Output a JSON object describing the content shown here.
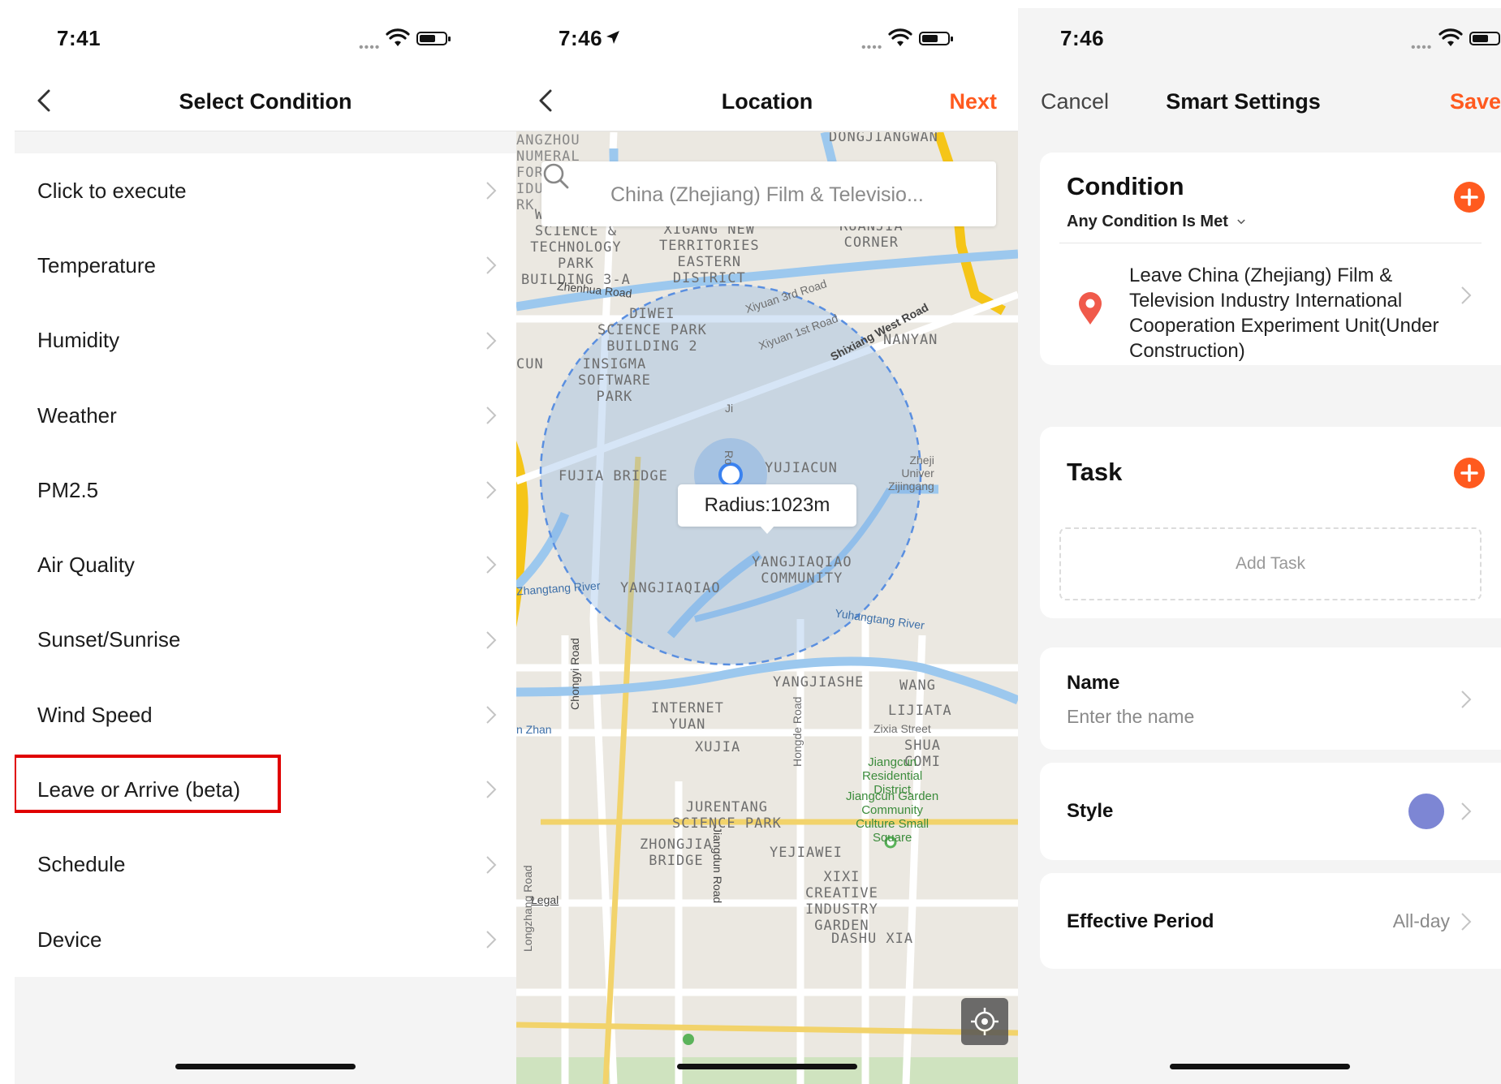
{
  "screen1": {
    "status_time": "7:41",
    "title": "Select Condition",
    "items": [
      {
        "label": "Click to execute"
      },
      {
        "label": "Temperature"
      },
      {
        "label": "Humidity"
      },
      {
        "label": "Weather"
      },
      {
        "label": "PM2.5"
      },
      {
        "label": "Air Quality"
      },
      {
        "label": "Sunset/Sunrise"
      },
      {
        "label": "Wind Speed"
      },
      {
        "label": "Leave or Arrive (beta)"
      },
      {
        "label": "Schedule"
      },
      {
        "label": "Device"
      }
    ],
    "highlight_color": "#e00000"
  },
  "screen2": {
    "status_time": "7:46",
    "title": "Location",
    "next_label": "Next",
    "search_text": "China (Zhejiang) Film & Televisio...",
    "radius_label": "Radius:1023m",
    "map_labels": {
      "angzhou": "ANGZHOU\nNUMERAL\nFOR\nIDU\nRK",
      "dongjiangwan": "DONGJIANGWAN",
      "westlake": "WEST LAKE\nSCIENCE &\nTECHNOLOGY\nPARK\nBUILDING 3-A",
      "xigang": "XIGANG NEW\nTERRITORIES\nEASTERN\nDISTRICT",
      "ruanjia": "RUANJIA\nCORNER",
      "zhenhua": "Zhenhua Road",
      "xiyuan3": "Xiyuan 3rd Road",
      "xiyuan1": "Xiyuan 1st Road",
      "shixiang": "Shixiang West Road",
      "diwei": "DIWEI\nSCIENCE PARK\nBUILDING 2",
      "nanyan": "NANYAN",
      "cun": "CUN",
      "insigma": "INSIGMA\nSOFTWARE\nPARK",
      "fujia": "FUJIA BRIDGE",
      "yujiacun": "YUJIACUN",
      "zheji": "Zheji\nUniver\nZijingang",
      "yangjiaqiao_comm": "YANGJIAQIAO\nCOMMUNITY",
      "zhangtang": "Zhangtang River",
      "yangjiaqiao": "YANGJIAQIAO",
      "yuhangtang": "Yuhangtang River",
      "yangjiashe": "YANGJIASHE",
      "wang": "WANG",
      "lijiata": "LIJIATA",
      "zixia": "Zixia Street",
      "chongyi": "Chongyi Road",
      "nzhan": "n Zhan",
      "internet": "INTERNET\nYUAN",
      "xujia": "XUJIA",
      "shua": "SHUA\nCOMI",
      "hongde": "Hongde Road",
      "jiangcun": "Jiangcun\nResidential\nDistrict",
      "jiangcun_garden": "Jiangcun Garden\nCommunity\nCulture Small\nSquare",
      "jurentang": "JURENTANG\nSCIENCE PARK",
      "zhongjia": "ZHONGJIA\nBRIDGE",
      "jiangdun": "Jiangdun Road",
      "yejiawei": "YEJIAWEI",
      "xixi": "XIXI\nCREATIVE\nINDUSTRY\nGARDEN",
      "longzhang": "Longzhang Road",
      "legal": "Legal",
      "dashu": "DASHU XIA",
      "ji": "Ji",
      "ro": "Ro"
    }
  },
  "screen3": {
    "status_time": "7:46",
    "cancel_label": "Cancel",
    "title": "Smart Settings",
    "save_label": "Save",
    "condition": {
      "heading": "Condition",
      "match_mode": "Any Condition Is Met",
      "item_text": "Leave China (Zhejiang) Film & Television Industry International Cooperation Experiment Unit(Under Construction)"
    },
    "task": {
      "heading": "Task",
      "add_label": "Add Task"
    },
    "name": {
      "label": "Name",
      "placeholder": "Enter the name"
    },
    "style": {
      "label": "Style",
      "color": "#7d86d4"
    },
    "period": {
      "label": "Effective Period",
      "value": "All-day"
    },
    "accent_color": "#ff5a1f"
  }
}
